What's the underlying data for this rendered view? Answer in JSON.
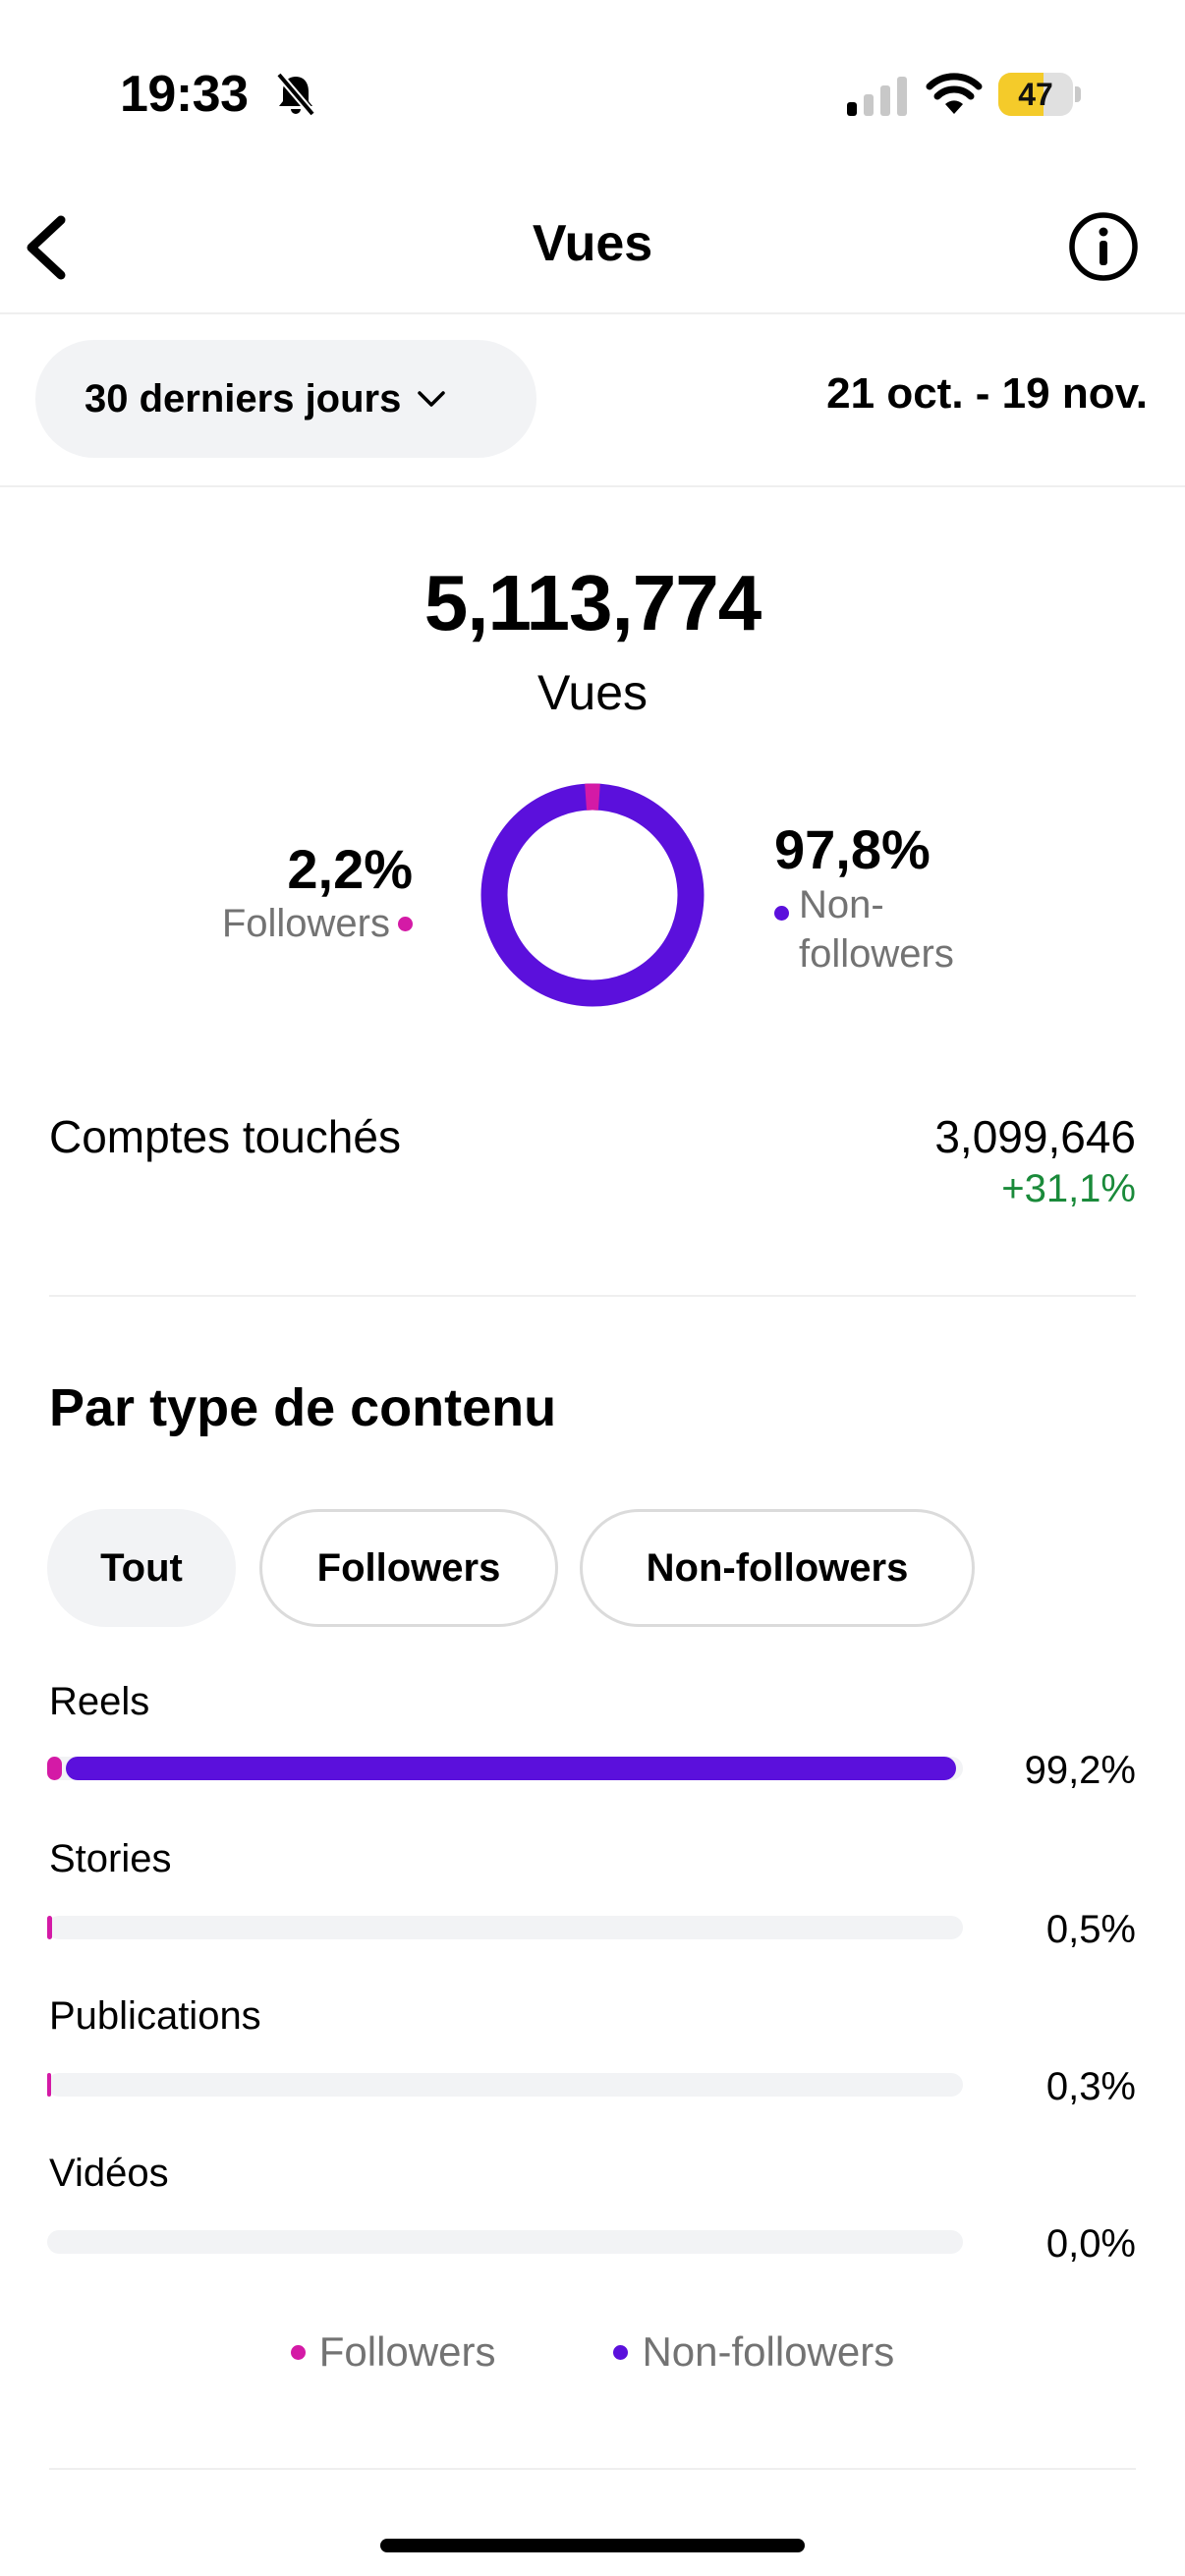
{
  "status_bar": {
    "time": "19:33",
    "battery": "47",
    "battery_level_pct": 60,
    "battery_color": "#f4cb2a"
  },
  "header": {
    "title": "Vues",
    "back_icon": "chevron-left-icon",
    "info_icon": "info-icon"
  },
  "period": {
    "selected": "30 derniers jours",
    "date_range": "21 oct. - 19 nov."
  },
  "summary": {
    "total": "5,113,774",
    "label": "Vues",
    "followers_pct": "2,2%",
    "followers_label": "Followers",
    "followers_value": 2.2,
    "nonfollowers_pct": "97,8%",
    "nonfollowers_label": "Non-followers",
    "nonfollowers_value": 97.8,
    "colors": {
      "followers": "#d41aa6",
      "nonfollowers": "#5b10dc"
    }
  },
  "reach": {
    "label": "Comptes touchés",
    "value": "3,099,646",
    "change": "+31,1%"
  },
  "content_type": {
    "title": "Par type de contenu",
    "filters": [
      {
        "label": "Tout",
        "selected": true
      },
      {
        "label": "Followers",
        "selected": false
      },
      {
        "label": "Non-followers",
        "selected": false
      }
    ],
    "rows": [
      {
        "label": "Reels",
        "pct": "99,2%",
        "followers_fraction": 0.016,
        "total_fraction": 0.992
      },
      {
        "label": "Stories",
        "pct": "0,5%",
        "followers_fraction": 0.005,
        "total_fraction": 0.005
      },
      {
        "label": "Publications",
        "pct": "0,3%",
        "followers_fraction": 0.002,
        "total_fraction": 0.003
      },
      {
        "label": "Vidéos",
        "pct": "0,0%",
        "followers_fraction": 0.0,
        "total_fraction": 0.0
      }
    ]
  },
  "legend": {
    "followers": "Followers",
    "nonfollowers": "Non-followers"
  }
}
